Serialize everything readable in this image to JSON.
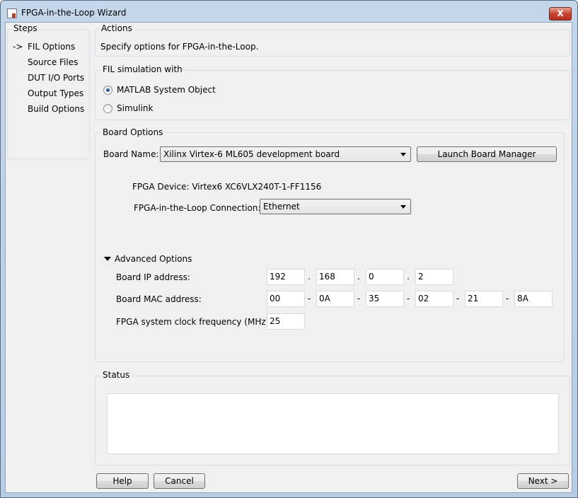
{
  "window": {
    "title": "FPGA-in-the-Loop Wizard",
    "close_label": "X"
  },
  "steps": {
    "title": "Steps",
    "current_marker": "->",
    "items": [
      {
        "label": "FIL Options"
      },
      {
        "label": "Source Files"
      },
      {
        "label": "DUT I/O Ports"
      },
      {
        "label": "Output Types"
      },
      {
        "label": "Build Options"
      }
    ]
  },
  "actions": {
    "title": "Actions",
    "text": "Specify options for FPGA-in-the-Loop."
  },
  "fil_sim": {
    "title": "FIL simulation with",
    "options": [
      {
        "label": "MATLAB System Object",
        "selected": true
      },
      {
        "label": "Simulink",
        "selected": false
      }
    ]
  },
  "board": {
    "title": "Board Options",
    "name_label": "Board Name:",
    "name_value": "Xilinx Virtex-6 ML605 development board",
    "launch_label": "Launch Board Manager",
    "device_text": "FPGA Device: Virtex6 XC6VLX240T-1-FF1156",
    "connection_label": "FPGA-in-the-Loop Connection:",
    "connection_value": "Ethernet"
  },
  "advanced": {
    "title": "Advanced Options",
    "ip_label": "Board IP address:",
    "ip": [
      "192",
      "168",
      "0",
      "2"
    ],
    "ip_sep": ".",
    "mac_label": "Board MAC address:",
    "mac": [
      "00",
      "0A",
      "35",
      "02",
      "21",
      "8A"
    ],
    "mac_sep": "-",
    "clock_label": "FPGA system clock frequency (MHz)",
    "clock": "25"
  },
  "status": {
    "title": "Status",
    "text": ""
  },
  "footer": {
    "help": "Help",
    "cancel": "Cancel",
    "next": "Next >"
  }
}
